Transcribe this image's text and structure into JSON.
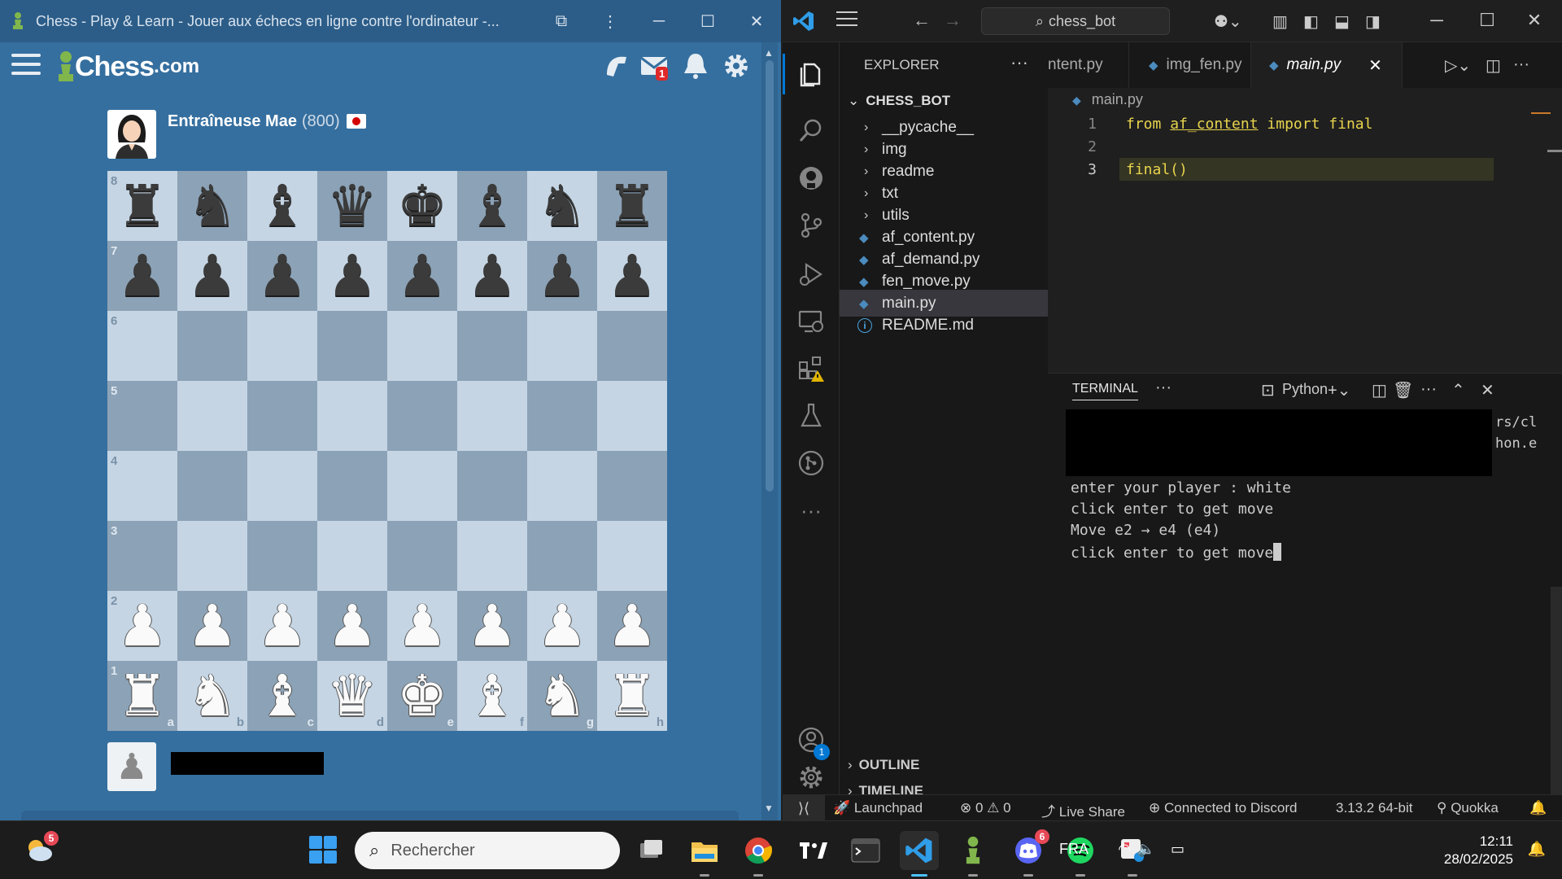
{
  "chess_window": {
    "title": "Chess - Play & Learn - Jouer aux échecs en ligne contre l'ordinateur -...",
    "logo_text": "Chess",
    "logo_suffix": ".com",
    "mail_badge": "1",
    "opponent": {
      "name": "Entraîneuse Mae",
      "rating": "(800)"
    },
    "board": {
      "ranks": [
        "8",
        "7",
        "6",
        "5",
        "4",
        "3",
        "2",
        "1"
      ],
      "files": [
        "a",
        "b",
        "c",
        "d",
        "e",
        "f",
        "g",
        "h"
      ],
      "rows": [
        [
          "r",
          "n",
          "b",
          "q",
          "k",
          "b",
          "n",
          "r"
        ],
        [
          "p",
          "p",
          "p",
          "p",
          "p",
          "p",
          "p",
          "p"
        ],
        [
          "",
          "",
          "",
          "",
          "",
          "",
          "",
          ""
        ],
        [
          "",
          "",
          "",
          "",
          "",
          "",
          "",
          ""
        ],
        [
          "",
          "",
          "",
          "",
          "",
          "",
          "",
          ""
        ],
        [
          "",
          "",
          "",
          "",
          "",
          "",
          "",
          ""
        ],
        [
          "P",
          "P",
          "P",
          "P",
          "P",
          "P",
          "P",
          "P"
        ],
        [
          "R",
          "N",
          "B",
          "Q",
          "K",
          "B",
          "N",
          "R"
        ]
      ]
    }
  },
  "vscode": {
    "search_text": "chess_bot",
    "explorer": {
      "header": "EXPLORER",
      "root": "CHESS_BOT",
      "folders": [
        "__pycache__",
        "img",
        "readme",
        "txt",
        "utils"
      ],
      "files": [
        "af_content.py",
        "af_demand.py",
        "fen_move.py",
        "main.py"
      ],
      "readme_file": "README.md",
      "sections": [
        "OUTLINE",
        "TIMELINE"
      ]
    },
    "tabs": [
      "ntent.py",
      "img_fen.py",
      "main.py"
    ],
    "breadcrumb": "main.py",
    "code": {
      "line_numbers": [
        "1",
        "2",
        "3"
      ],
      "line1": {
        "from": "from",
        "module": "af_content",
        "import": "import",
        "name": "final"
      },
      "line3": "final()"
    },
    "terminal": {
      "title": "TERMINAL",
      "shell": "Python",
      "peek": [
        "rs/cl",
        "hon.e"
      ],
      "lines": [
        "enter your player : white",
        "click enter to get move",
        "Move e2 → e4 (e4)",
        "click enter to get move"
      ]
    },
    "status": {
      "launchpad": "Launchpad",
      "errors": "0",
      "warnings": "0",
      "live_share": "Live Share",
      "discord": "Connected to Discord",
      "python_version": "3.13.2 64-bit",
      "quokka": "Quokka"
    },
    "accounts_badge": "1"
  },
  "taskbar": {
    "weather_badge": "5",
    "search_placeholder": "Rechercher",
    "discord_badge": "6",
    "language": "FRA",
    "time": "12:11",
    "date": "28/02/2025"
  },
  "colors": {
    "chess_bg": "#356f9f",
    "board_light": "#c5d5e4",
    "board_dark": "#8ca2b6",
    "vscode_bg": "#1f1f1f",
    "accent_blue": "#0078d4"
  }
}
